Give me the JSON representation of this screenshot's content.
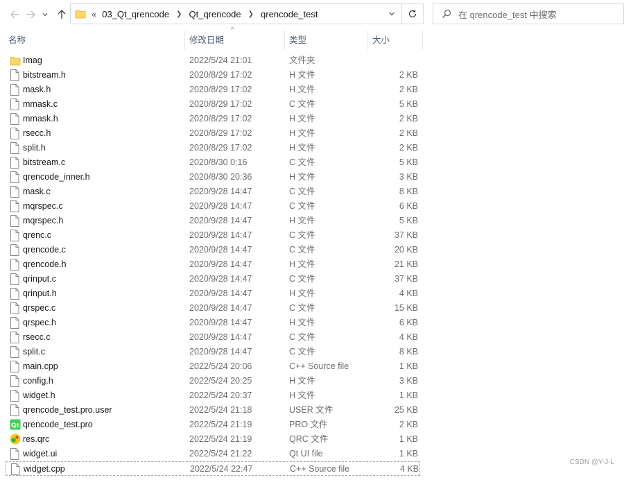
{
  "nav": {
    "breadcrumb": [
      "03_Qt_qrencode",
      "Qt_qrencode",
      "qrencode_test"
    ],
    "overflow": "«",
    "search_placeholder": "在 qrencode_test 中搜索"
  },
  "columns": {
    "name": "名称",
    "date": "修改日期",
    "type": "类型",
    "size": "大小"
  },
  "files": [
    {
      "name": "Imag",
      "date": "2022/5/24 21:01",
      "type": "文件夹",
      "size": "",
      "icon": "folder-icon"
    },
    {
      "name": "bitstream.h",
      "date": "2020/8/29 17:02",
      "type": "H 文件",
      "size": "2 KB",
      "icon": "file-icon"
    },
    {
      "name": "mask.h",
      "date": "2020/8/29 17:02",
      "type": "H 文件",
      "size": "2 KB",
      "icon": "file-icon"
    },
    {
      "name": "mmask.c",
      "date": "2020/8/29 17:02",
      "type": "C 文件",
      "size": "5 KB",
      "icon": "file-icon"
    },
    {
      "name": "mmask.h",
      "date": "2020/8/29 17:02",
      "type": "H 文件",
      "size": "2 KB",
      "icon": "file-icon"
    },
    {
      "name": "rsecc.h",
      "date": "2020/8/29 17:02",
      "type": "H 文件",
      "size": "2 KB",
      "icon": "file-icon"
    },
    {
      "name": "split.h",
      "date": "2020/8/29 17:02",
      "type": "H 文件",
      "size": "2 KB",
      "icon": "file-icon"
    },
    {
      "name": "bitstream.c",
      "date": "2020/8/30 0:16",
      "type": "C 文件",
      "size": "5 KB",
      "icon": "file-icon"
    },
    {
      "name": "qrencode_inner.h",
      "date": "2020/8/30 20:36",
      "type": "H 文件",
      "size": "3 KB",
      "icon": "file-icon"
    },
    {
      "name": "mask.c",
      "date": "2020/9/28 14:47",
      "type": "C 文件",
      "size": "8 KB",
      "icon": "file-icon"
    },
    {
      "name": "mqrspec.c",
      "date": "2020/9/28 14:47",
      "type": "C 文件",
      "size": "6 KB",
      "icon": "file-icon"
    },
    {
      "name": "mqrspec.h",
      "date": "2020/9/28 14:47",
      "type": "H 文件",
      "size": "5 KB",
      "icon": "file-icon"
    },
    {
      "name": "qrenc.c",
      "date": "2020/9/28 14:47",
      "type": "C 文件",
      "size": "37 KB",
      "icon": "file-icon"
    },
    {
      "name": "qrencode.c",
      "date": "2020/9/28 14:47",
      "type": "C 文件",
      "size": "20 KB",
      "icon": "file-icon"
    },
    {
      "name": "qrencode.h",
      "date": "2020/9/28 14:47",
      "type": "H 文件",
      "size": "21 KB",
      "icon": "file-icon"
    },
    {
      "name": "qrinput.c",
      "date": "2020/9/28 14:47",
      "type": "C 文件",
      "size": "37 KB",
      "icon": "file-icon"
    },
    {
      "name": "qrinput.h",
      "date": "2020/9/28 14:47",
      "type": "H 文件",
      "size": "4 KB",
      "icon": "file-icon"
    },
    {
      "name": "qrspec.c",
      "date": "2020/9/28 14:47",
      "type": "C 文件",
      "size": "15 KB",
      "icon": "file-icon"
    },
    {
      "name": "qrspec.h",
      "date": "2020/9/28 14:47",
      "type": "H 文件",
      "size": "6 KB",
      "icon": "file-icon"
    },
    {
      "name": "rsecc.c",
      "date": "2020/9/28 14:47",
      "type": "C 文件",
      "size": "4 KB",
      "icon": "file-icon"
    },
    {
      "name": "split.c",
      "date": "2020/9/28 14:47",
      "type": "C 文件",
      "size": "8 KB",
      "icon": "file-icon"
    },
    {
      "name": "main.cpp",
      "date": "2022/5/24 20:06",
      "type": "C++ Source file",
      "size": "1 KB",
      "icon": "file-icon"
    },
    {
      "name": "config.h",
      "date": "2022/5/24 20:25",
      "type": "H 文件",
      "size": "3 KB",
      "icon": "file-icon"
    },
    {
      "name": "widget.h",
      "date": "2022/5/24 20:37",
      "type": "H 文件",
      "size": "1 KB",
      "icon": "file-icon"
    },
    {
      "name": "qrencode_test.pro.user",
      "date": "2022/5/24 21:18",
      "type": "USER 文件",
      "size": "25 KB",
      "icon": "file-icon"
    },
    {
      "name": "qrencode_test.pro",
      "date": "2022/5/24 21:19",
      "type": "PRO 文件",
      "size": "2 KB",
      "icon": "qt-pro-icon"
    },
    {
      "name": "res.qrc",
      "date": "2022/5/24 21:19",
      "type": "QRC 文件",
      "size": "1 KB",
      "icon": "qrc-icon"
    },
    {
      "name": "widget.ui",
      "date": "2022/5/24 21:22",
      "type": "Qt UI file",
      "size": "1 KB",
      "icon": "file-icon"
    },
    {
      "name": "widget.cpp",
      "date": "2022/5/24 22:47",
      "type": "C++ Source file",
      "size": "4 KB",
      "icon": "file-icon"
    }
  ],
  "watermark": "CSDN @Y-J-L"
}
